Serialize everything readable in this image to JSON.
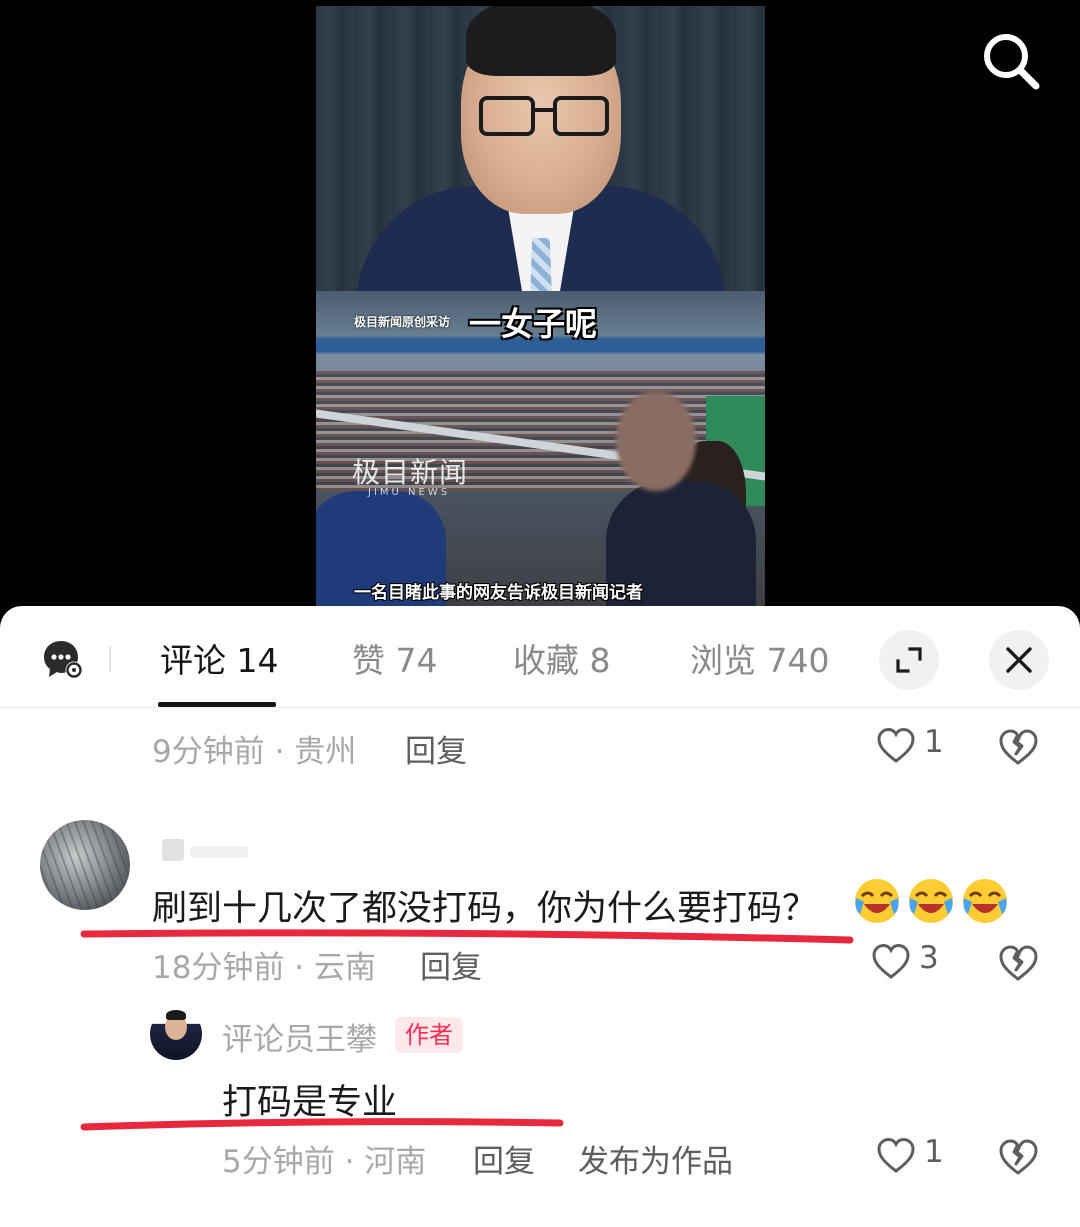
{
  "video": {
    "source_tag": "极目新闻原创采访",
    "headline": "一女子呢",
    "watermark_logo": "极目新闻",
    "watermark_sub": "JIMU NEWS",
    "caption": "一名目睹此事的网友告诉极目新闻记者"
  },
  "top_bar": {
    "search_icon": "search-icon"
  },
  "tabs": [
    {
      "label": "评论 14",
      "active": true
    },
    {
      "label": "赞 74",
      "active": false
    },
    {
      "label": "收藏 8",
      "active": false
    },
    {
      "label": "浏览 740",
      "active": false
    }
  ],
  "header_icons": {
    "settings": "chat-settings-icon",
    "expand": "expand-icon",
    "close": "close-icon"
  },
  "comments": [
    {
      "meta": "9分钟前 · 贵州",
      "reply": "回复",
      "likes": "1"
    },
    {
      "text": "刷到十几次了都没打码，你为什么要打码？",
      "emojis": [
        "😂",
        "😂",
        "😂"
      ],
      "meta": "18分钟前 · 云南",
      "reply": "回复",
      "likes": "3"
    },
    {
      "author": "评论员王攀",
      "badge": "作者",
      "text": "打码是专业",
      "meta": "5分钟前 · 河南",
      "reply": "回复",
      "publish": "发布为作品",
      "likes": "1"
    }
  ],
  "colors": {
    "accent_red": "#ff2c55",
    "underline_red": "#e8283c"
  }
}
